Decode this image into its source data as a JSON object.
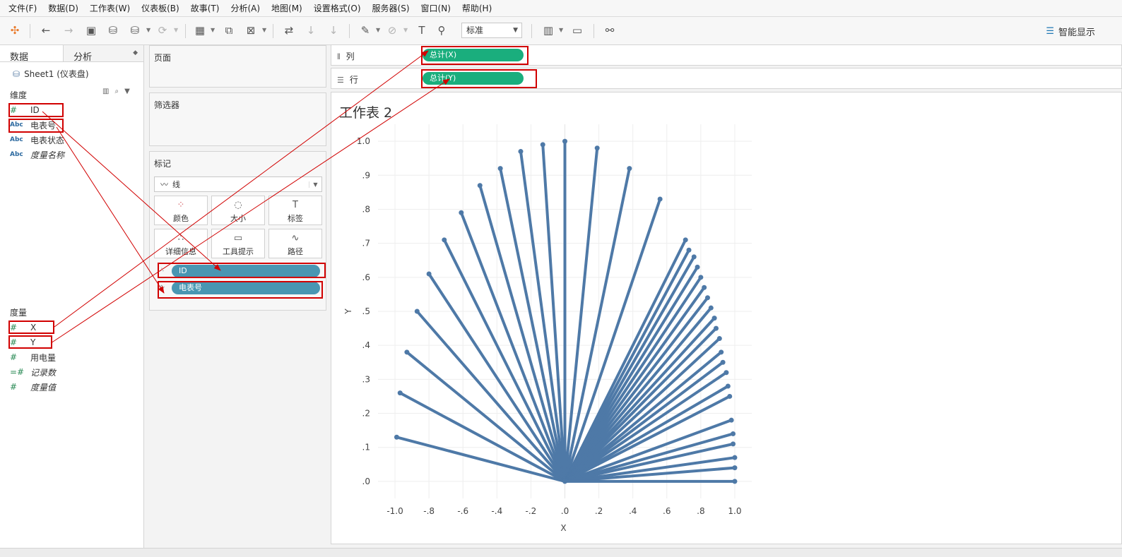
{
  "menu": [
    "文件(F)",
    "数据(D)",
    "工作表(W)",
    "仪表板(B)",
    "故事(T)",
    "分析(A)",
    "地图(M)",
    "设置格式(O)",
    "服务器(S)",
    "窗口(N)",
    "帮助(H)"
  ],
  "toolbar": {
    "fit": "标准",
    "show_me": "智能显示"
  },
  "data_pane": {
    "tabs": [
      "数据",
      "分析"
    ],
    "datasource": "Sheet1 (仪表盘)",
    "dimensions_label": "维度",
    "dimensions": [
      {
        "type": "#",
        "name": "ID"
      },
      {
        "type": "Abc",
        "name": "电表号"
      },
      {
        "type": "Abc",
        "name": "电表状态"
      },
      {
        "type": "Abc",
        "name": "度量名称"
      }
    ],
    "measures_label": "度量",
    "measures": [
      {
        "type": "#",
        "name": "X"
      },
      {
        "type": "#",
        "name": "Y"
      },
      {
        "type": "#",
        "name": "用电量"
      },
      {
        "type": "=#",
        "name": "记录数"
      },
      {
        "type": "#",
        "name": "度量值"
      }
    ]
  },
  "cards": {
    "pages": "页面",
    "filters": "筛选器",
    "marks": "标记"
  },
  "marks": {
    "type": "线",
    "buttons": [
      "颜色",
      "大小",
      "标签",
      "详细信息",
      "工具提示",
      "路径"
    ],
    "pills": [
      "ID",
      "电表号"
    ]
  },
  "shelves": {
    "columns_label": "列",
    "columns_pill": "总计(X)",
    "rows_label": "行",
    "rows_pill": "总计(Y)"
  },
  "sheet_title": "工作表 2",
  "chart_data": {
    "type": "line",
    "xlabel": "X",
    "ylabel": "Y",
    "xlim": [
      -1.1,
      1.1
    ],
    "ylim": [
      -0.05,
      1.05
    ],
    "x_ticks": [
      "-1.0",
      "-.8",
      "-.6",
      "-.4",
      "-.2",
      ".0",
      ".2",
      ".4",
      ".6",
      ".8",
      "1.0"
    ],
    "y_ticks": [
      ".0",
      ".1",
      ".2",
      ".3",
      ".4",
      ".5",
      ".6",
      ".7",
      ".8",
      ".9",
      "1.0"
    ],
    "color": "#4e79a7",
    "origin": [
      0,
      0
    ],
    "endpoints": [
      [
        -0.99,
        0.13
      ],
      [
        -0.97,
        0.26
      ],
      [
        -0.93,
        0.38
      ],
      [
        -0.87,
        0.5
      ],
      [
        -0.8,
        0.61
      ],
      [
        -0.71,
        0.71
      ],
      [
        -0.61,
        0.79
      ],
      [
        -0.5,
        0.87
      ],
      [
        -0.38,
        0.92
      ],
      [
        -0.26,
        0.97
      ],
      [
        -0.13,
        0.99
      ],
      [
        0.0,
        1.0
      ],
      [
        0.19,
        0.98
      ],
      [
        0.38,
        0.92
      ],
      [
        0.56,
        0.83
      ],
      [
        0.71,
        0.71
      ],
      [
        0.73,
        0.68
      ],
      [
        0.76,
        0.66
      ],
      [
        0.78,
        0.63
      ],
      [
        0.8,
        0.6
      ],
      [
        0.82,
        0.57
      ],
      [
        0.84,
        0.54
      ],
      [
        0.86,
        0.51
      ],
      [
        0.88,
        0.48
      ],
      [
        0.89,
        0.45
      ],
      [
        0.91,
        0.42
      ],
      [
        0.92,
        0.38
      ],
      [
        0.93,
        0.35
      ],
      [
        0.95,
        0.32
      ],
      [
        0.96,
        0.28
      ],
      [
        0.97,
        0.25
      ],
      [
        0.98,
        0.18
      ],
      [
        0.99,
        0.14
      ],
      [
        0.99,
        0.11
      ],
      [
        1.0,
        0.07
      ],
      [
        1.0,
        0.04
      ],
      [
        1.0,
        0.0
      ]
    ]
  }
}
